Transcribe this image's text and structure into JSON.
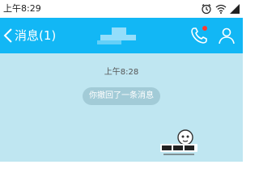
{
  "status_bar": {
    "time": "上午8:29",
    "icons": [
      "alarm-icon",
      "wifi-icon",
      "signal-icon"
    ]
  },
  "nav": {
    "back_label": "消息(1)",
    "icons": [
      "back-chevron-icon",
      "phone-icon",
      "profile-icon"
    ],
    "notification_dot_color": "#ff3b30"
  },
  "chat": {
    "timestamp": "上午8:28",
    "recall_notice": "你撤回了一条消息"
  },
  "colors": {
    "nav_bg": "#12b7f5",
    "chat_bg": "#bfe6f1",
    "pill_bg": "#a2cbd7"
  }
}
